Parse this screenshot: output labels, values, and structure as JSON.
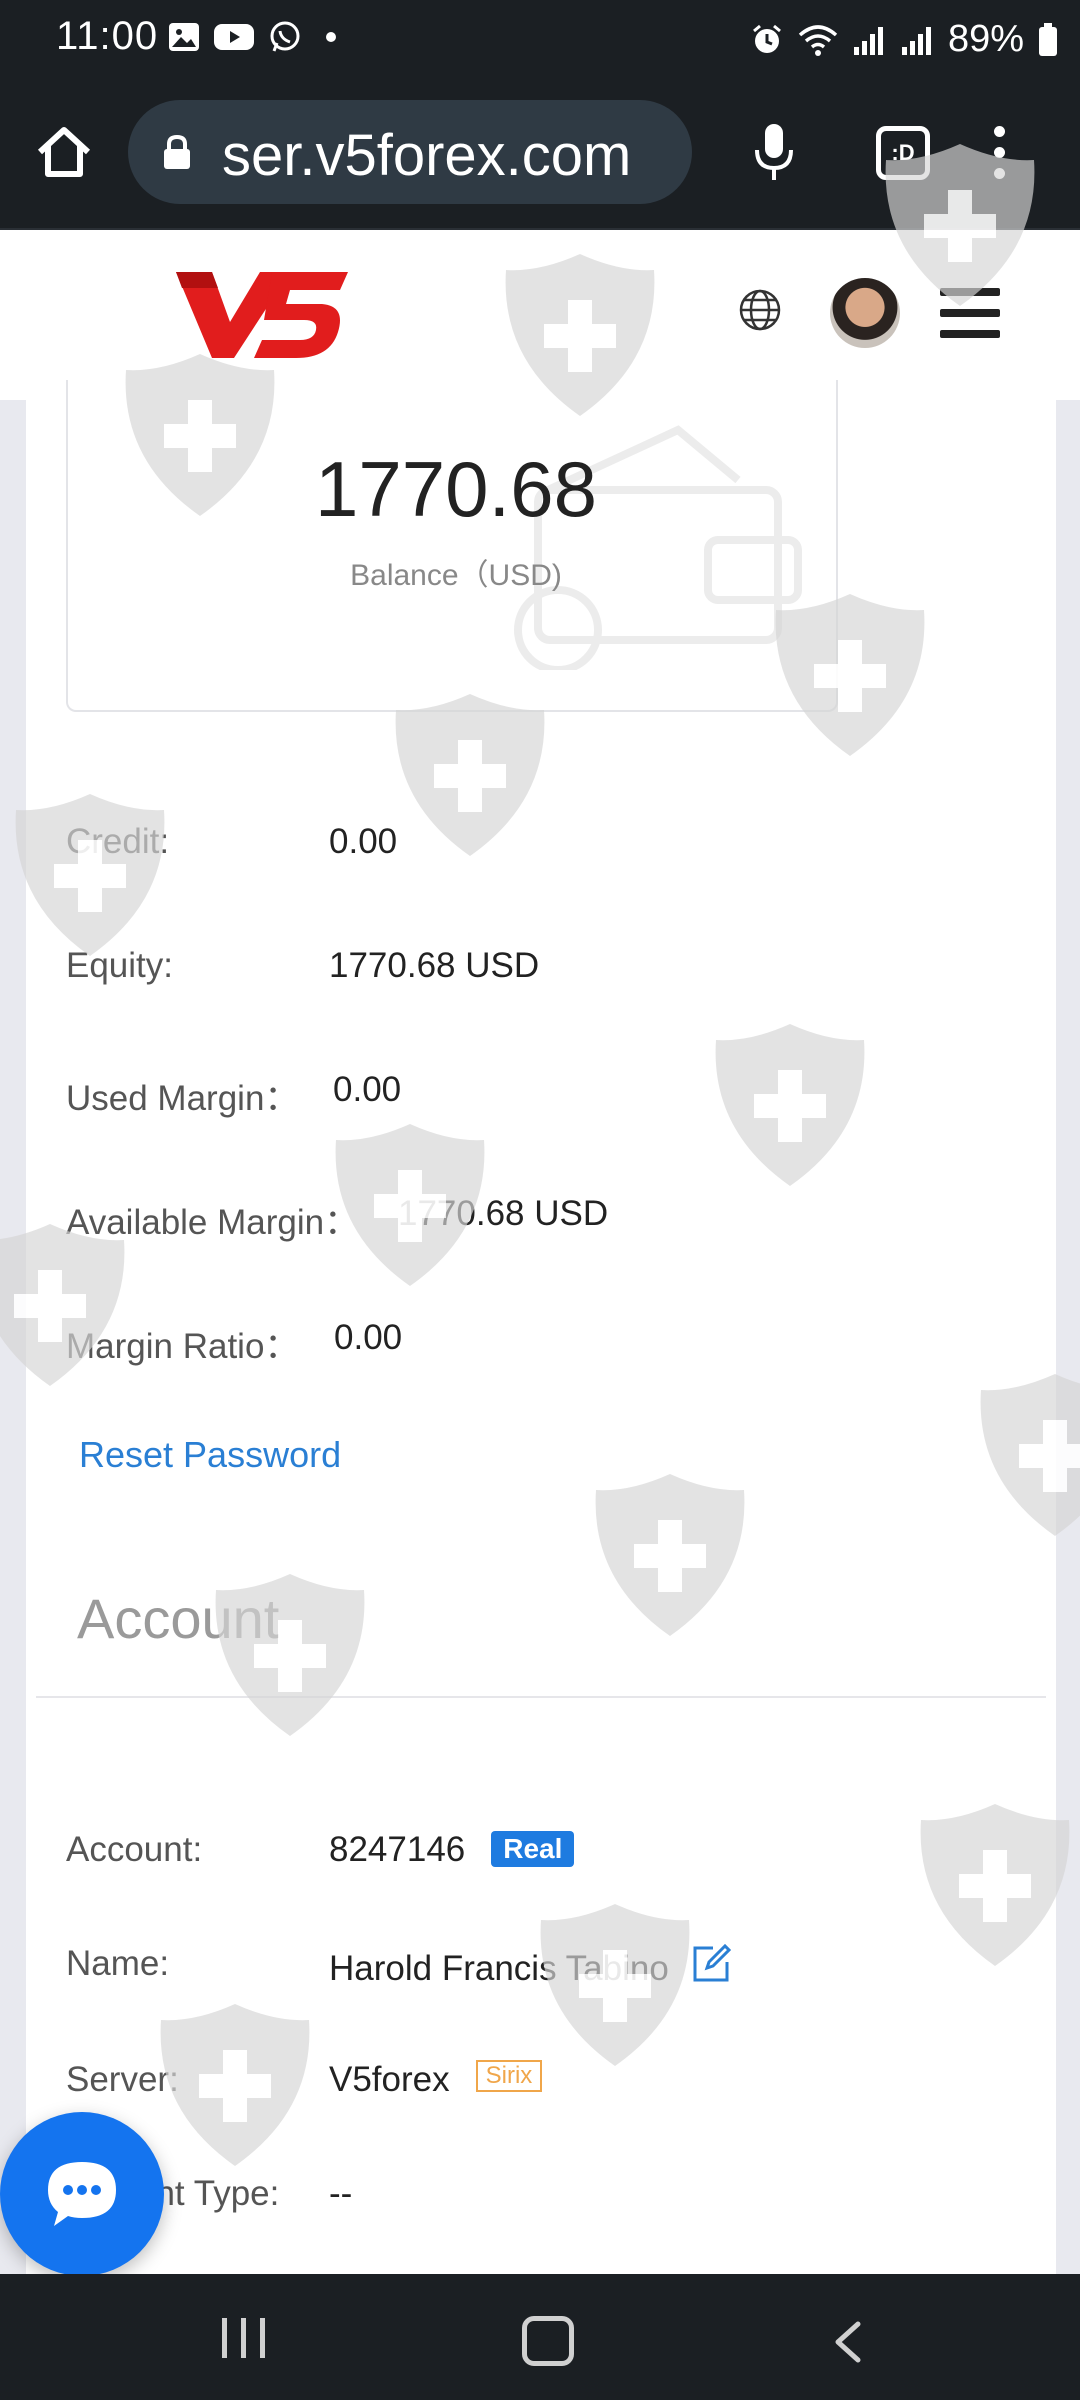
{
  "status_bar": {
    "time": "11:00",
    "left_icons": [
      "image-icon",
      "youtube-icon",
      "whatsapp-icon",
      "notification-dot"
    ],
    "right_icons": [
      "alarm-icon",
      "wifi-icon",
      "signal-icon",
      "signal-icon-2"
    ],
    "battery_percent": "89%"
  },
  "browser": {
    "url": "ser.v5forex.com",
    "tab_button_label": ":D"
  },
  "header": {
    "logo_text": "V5"
  },
  "balance": {
    "value": "1770.68",
    "label": "Balance（USD)"
  },
  "stats": [
    {
      "label": "Credit:",
      "value": "0.00"
    },
    {
      "label": "Equity:",
      "value": "1770.68 USD"
    },
    {
      "label": "Used Margin：",
      "value": "0.00"
    },
    {
      "label": "Available Margin：",
      "value": "1770.68 USD"
    },
    {
      "label": "Margin Ratio：",
      "value": "0.00"
    }
  ],
  "reset_password_label": "Reset Password",
  "account_section": {
    "title": "Account",
    "account_label": "Account:",
    "account_number": "8247146",
    "account_badge": "Real",
    "name_label": "Name:",
    "name_value": "Harold Francis Tabino",
    "server_label": "Server:",
    "server_value": "V5forex",
    "server_badge": "Sirix",
    "type_label": "unt Type:",
    "type_value": "--"
  },
  "colors": {
    "accent_blue": "#1e7be0",
    "link_blue": "#2a7fd4",
    "logo_red": "#e11d1d",
    "sirix_orange": "#f0a64a",
    "system_bar": "#1b1f23"
  }
}
